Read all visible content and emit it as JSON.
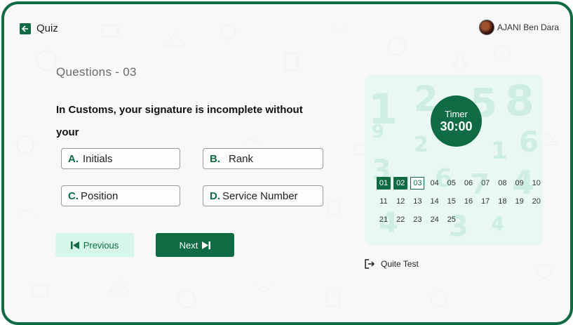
{
  "header": {
    "title": "Quiz",
    "user_name": "AJANI Ben Dara"
  },
  "question": {
    "number_label": "Questions - 03",
    "text": "In Customs, your signature is incomplete without your",
    "options": [
      {
        "letter": "A.",
        "label": "Initials"
      },
      {
        "letter": "B.",
        "label": "Rank"
      },
      {
        "letter": "C.",
        "label": "Position"
      },
      {
        "letter": "D.",
        "label": "Service Number"
      }
    ]
  },
  "nav": {
    "previous_label": "Previous",
    "next_label": "Next"
  },
  "timer": {
    "label": "Timer",
    "value": "30:00"
  },
  "question_grid": {
    "numbers": [
      "01",
      "02",
      "03",
      "04",
      "05",
      "06",
      "07",
      "08",
      "09",
      "10",
      "11",
      "12",
      "13",
      "14",
      "15",
      "16",
      "17",
      "18",
      "19",
      "20",
      "21",
      "22",
      "23",
      "24",
      "25"
    ],
    "answered": [
      "01",
      "02"
    ],
    "current": "03"
  },
  "quit": {
    "label": "Quite Test"
  },
  "colors": {
    "primary": "#0f6b43",
    "light": "#d6f6ea",
    "panel": "#e9f8f2"
  }
}
